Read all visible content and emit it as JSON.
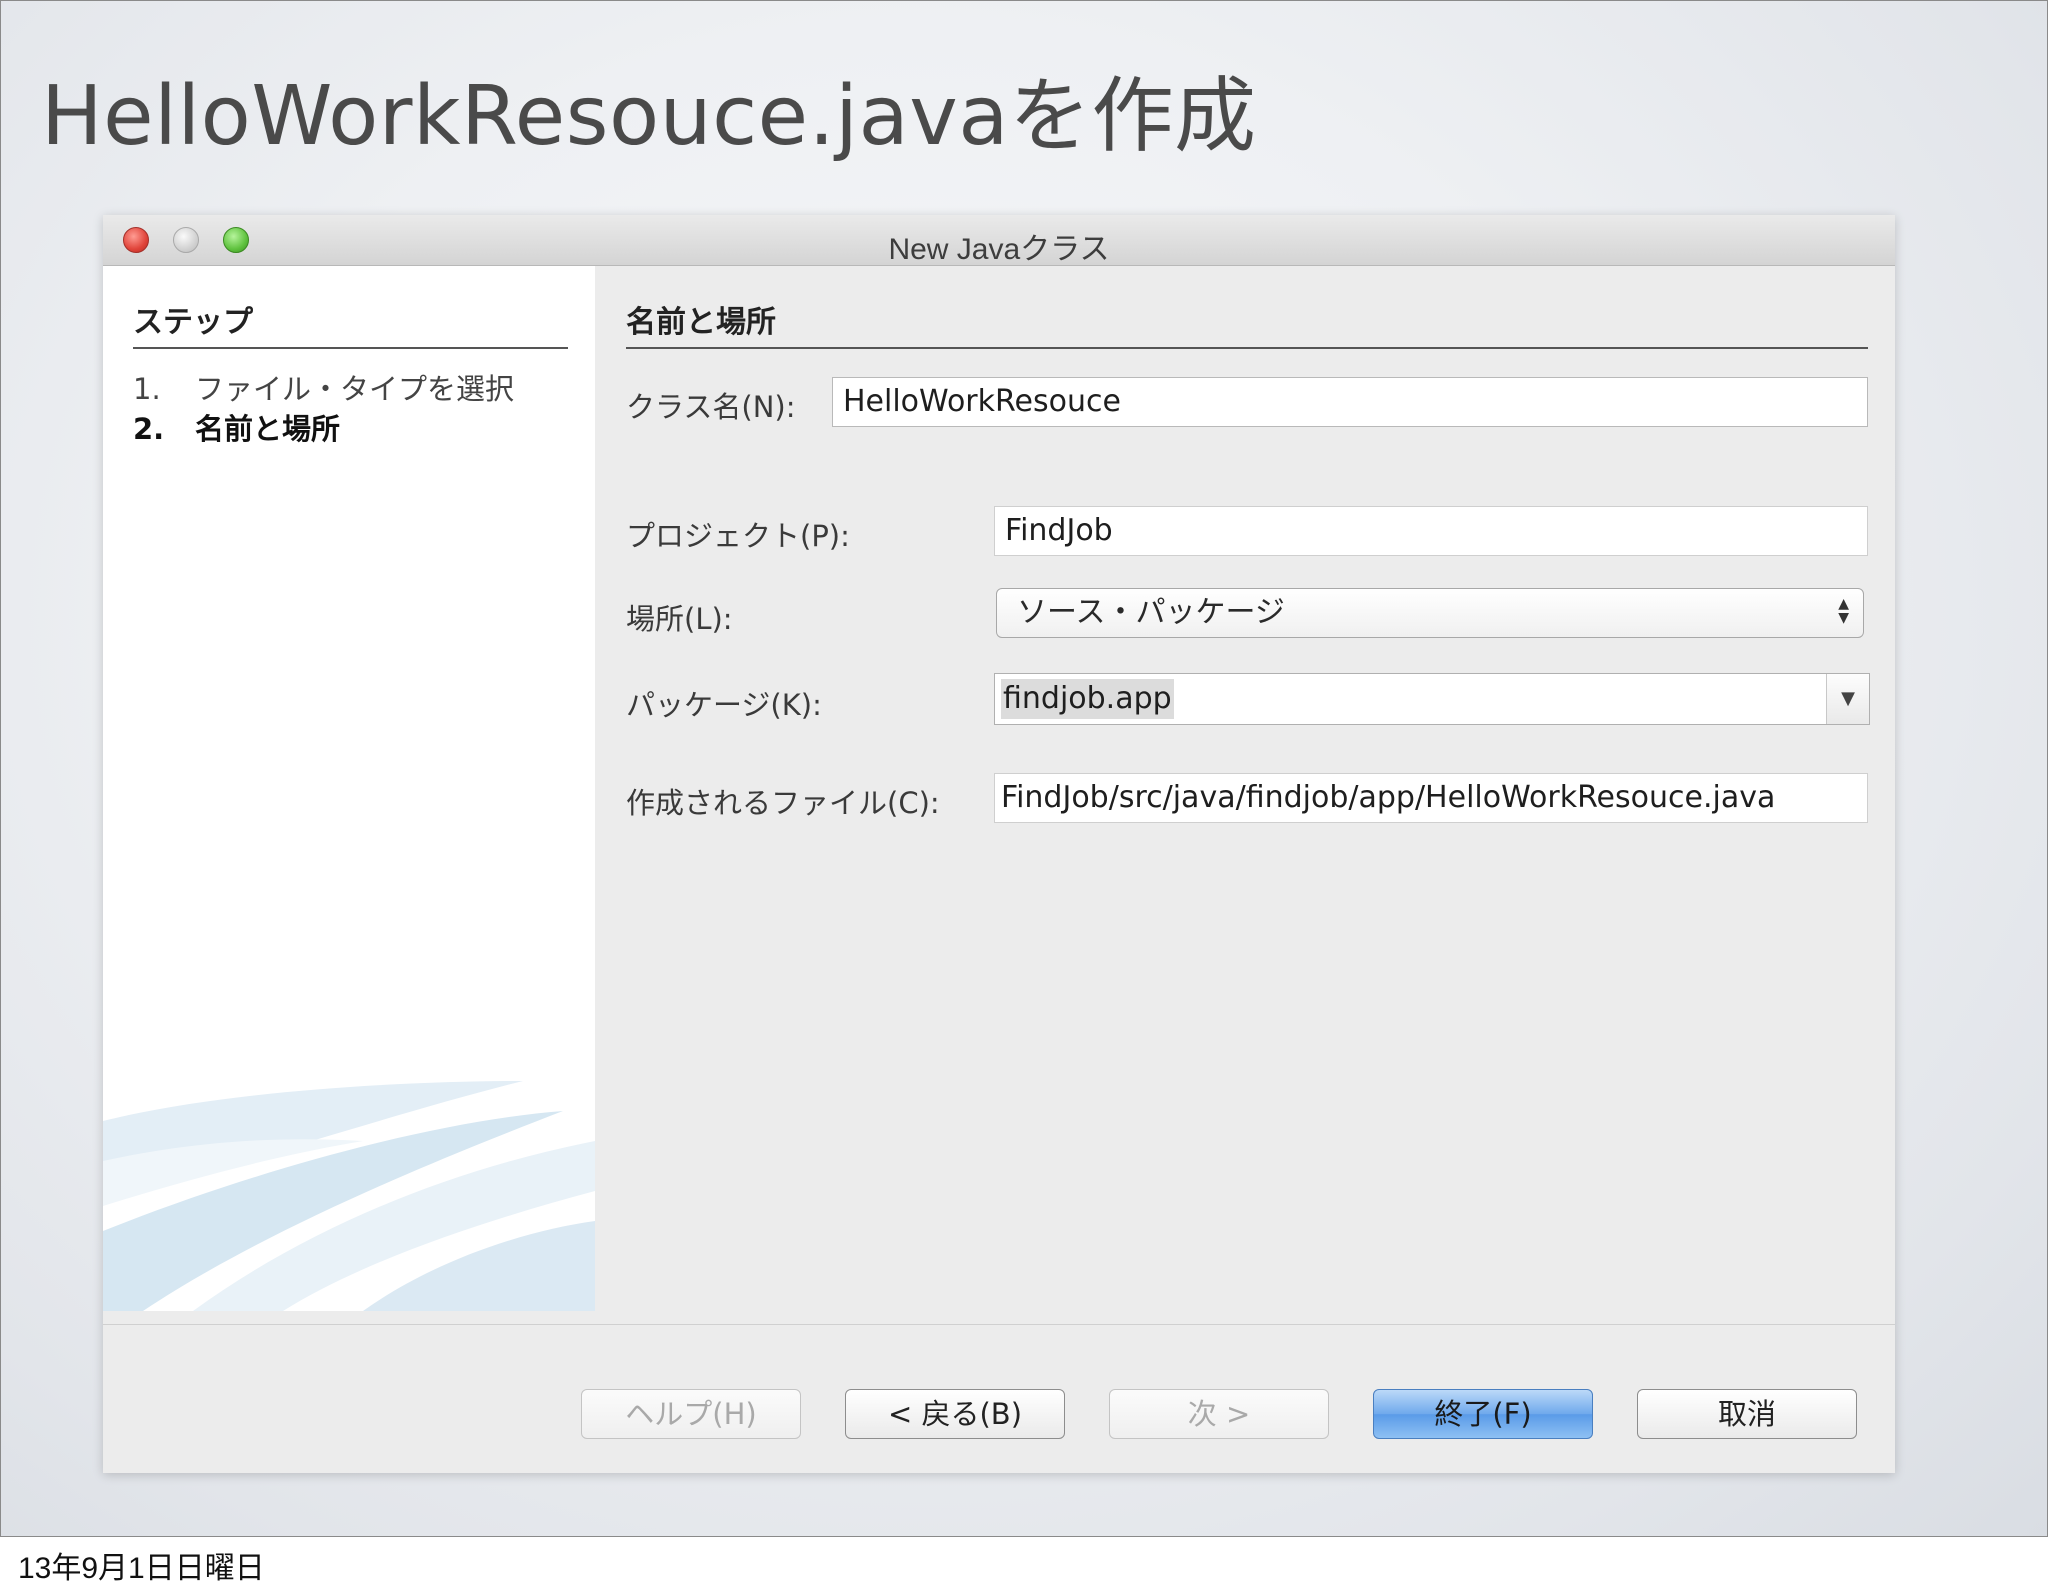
{
  "slide": {
    "title": "HelloWorkResouce.javaを作成",
    "footer_date": "13年9月1日日曜日"
  },
  "window": {
    "title": "New Javaクラス"
  },
  "steps_panel": {
    "heading": "ステップ",
    "items": [
      {
        "number": "1.",
        "label": "ファイル・タイプを選択",
        "current": false
      },
      {
        "number": "2.",
        "label": "名前と場所",
        "current": true
      }
    ]
  },
  "form": {
    "heading": "名前と場所",
    "class_name": {
      "label": "クラス名(N):",
      "value": "HelloWorkResouce"
    },
    "project": {
      "label": "プロジェクト(P):",
      "value": "FindJob"
    },
    "location": {
      "label": "場所(L):",
      "value": "ソース・パッケージ"
    },
    "package": {
      "label": "パッケージ(K):",
      "value": "findjob.app"
    },
    "created_file": {
      "label": "作成されるファイル(C):",
      "value": "FindJob/src/java/findjob/app/HelloWorkResouce.java"
    }
  },
  "buttons": {
    "help": "ヘルプ(H)",
    "back": "< 戻る(B)",
    "next": "次 >",
    "finish": "終了(F)",
    "cancel": "取消"
  }
}
